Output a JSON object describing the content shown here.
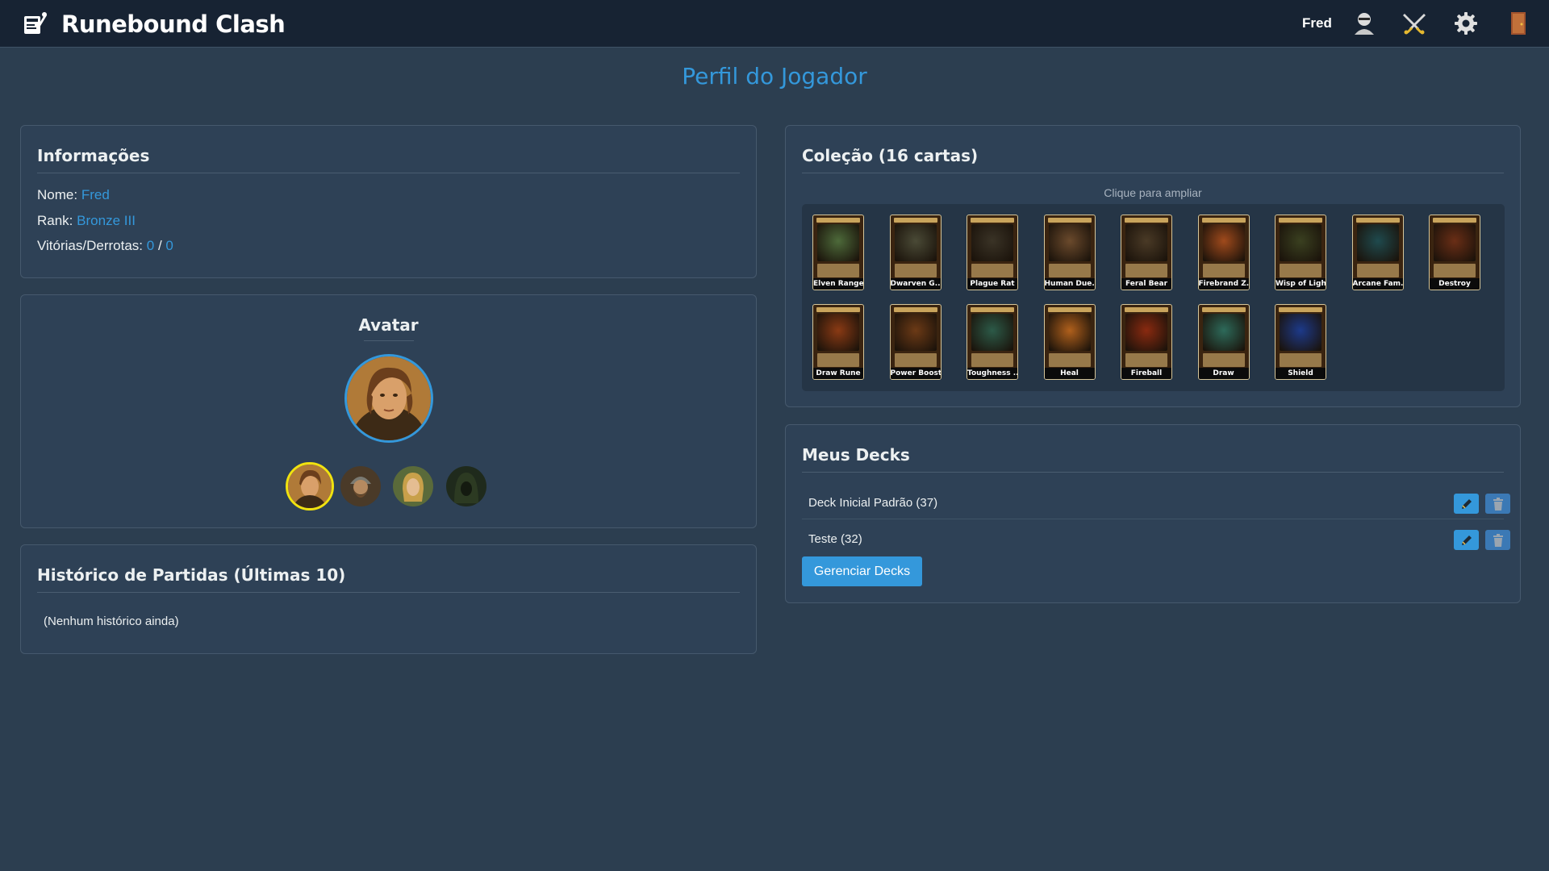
{
  "header": {
    "app_title": "Runebound Clash",
    "user_name": "Fred",
    "icons": [
      "logo-icon",
      "profile-icon",
      "battle-icon",
      "settings-icon",
      "exit-door-icon"
    ]
  },
  "page_title": "Perfil do Jogador",
  "info": {
    "title": "Informações",
    "name_label": "Nome:",
    "name_value": "Fred",
    "rank_label": "Rank:",
    "rank_value": "Bronze III",
    "record_label": "Vitórias/Derrotas:",
    "wins": "0",
    "separator": "/",
    "losses": "0"
  },
  "avatar": {
    "title": "Avatar",
    "options": [
      "hero-brown-hair",
      "dwarf-warrior",
      "elf-blonde",
      "hooded-figure"
    ],
    "selected_index": 0
  },
  "history": {
    "title": "Histórico de Partidas (Últimas 10)",
    "empty_text": "(Nenhum histórico ainda)"
  },
  "collection": {
    "title": "Coleção (16 cartas)",
    "hint": "Clique para ampliar",
    "cards": [
      {
        "name": "Elven Ranger",
        "color": "#4d6a3a"
      },
      {
        "name": "Dwarven G...",
        "color": "#4a4a36"
      },
      {
        "name": "Plague Rat",
        "color": "#3a3326"
      },
      {
        "name": "Human Due...",
        "color": "#6b4a2c"
      },
      {
        "name": "Feral Bear",
        "color": "#4a3a26"
      },
      {
        "name": "Firebrand Z...",
        "color": "#a04a1c"
      },
      {
        "name": "Wisp of Light",
        "color": "#3a4020"
      },
      {
        "name": "Arcane Fam...",
        "color": "#1f4a4e"
      },
      {
        "name": "Destroy",
        "color": "#6a2e16"
      },
      {
        "name": "Draw Rune",
        "color": "#8a3a14"
      },
      {
        "name": "Power Boost",
        "color": "#6c3a16"
      },
      {
        "name": "Toughness ...",
        "color": "#2c5a48"
      },
      {
        "name": "Heal",
        "color": "#b0601c"
      },
      {
        "name": "Fireball",
        "color": "#8a2a10"
      },
      {
        "name": "Draw",
        "color": "#2d6a5a"
      },
      {
        "name": "Shield",
        "color": "#1d3a8a"
      }
    ]
  },
  "decks": {
    "title": "Meus Decks",
    "items": [
      {
        "name": "Deck Inicial Padrão (37)"
      },
      {
        "name": "Teste (32)"
      }
    ],
    "manage_label": "Gerenciar Decks",
    "edit_icon": "pencil-icon",
    "delete_icon": "trash-icon"
  }
}
